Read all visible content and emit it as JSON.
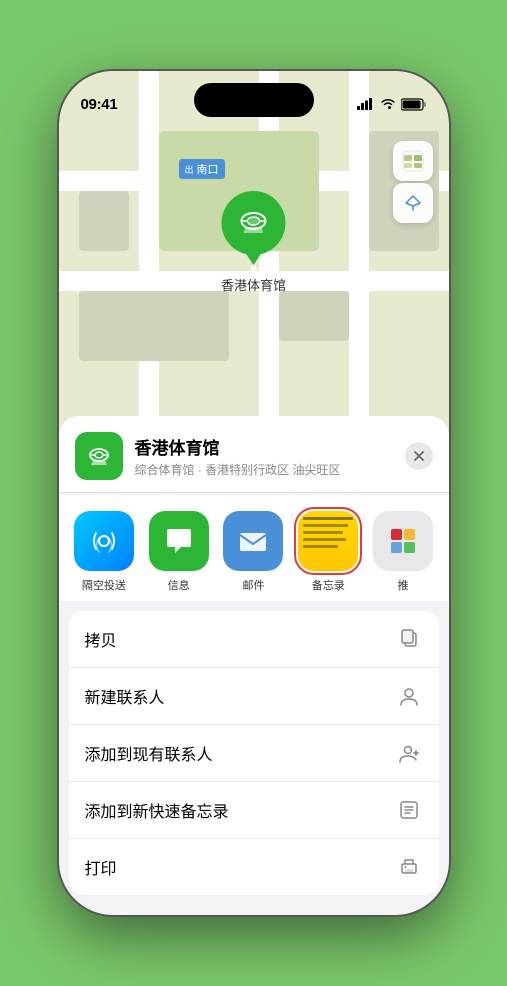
{
  "status_bar": {
    "time": "09:41",
    "signal_bars": "▌▌▌",
    "wifi": "WiFi",
    "battery": "Battery"
  },
  "map": {
    "label_text": "南口",
    "pin_label": "香港体育馆",
    "map_type_icon": "map-icon",
    "location_icon": "location-icon"
  },
  "venue": {
    "name": "香港体育馆",
    "subtitle": "综合体育馆 · 香港特别行政区 油尖旺区",
    "close_label": "×"
  },
  "share_items": [
    {
      "id": "airdrop",
      "label": "隔空投送",
      "type": "airdrop"
    },
    {
      "id": "messages",
      "label": "信息",
      "type": "messages"
    },
    {
      "id": "mail",
      "label": "邮件",
      "type": "mail"
    },
    {
      "id": "notes",
      "label": "备忘录",
      "type": "notes"
    },
    {
      "id": "more",
      "label": "推",
      "type": "more-btn"
    }
  ],
  "actions": [
    {
      "id": "copy",
      "label": "拷贝",
      "icon": "copy-icon"
    },
    {
      "id": "new-contact",
      "label": "新建联系人",
      "icon": "new-contact-icon"
    },
    {
      "id": "add-contact",
      "label": "添加到现有联系人",
      "icon": "add-contact-icon"
    },
    {
      "id": "add-notes",
      "label": "添加到新快速备忘录",
      "icon": "add-notes-icon"
    },
    {
      "id": "print",
      "label": "打印",
      "icon": "print-icon"
    }
  ]
}
